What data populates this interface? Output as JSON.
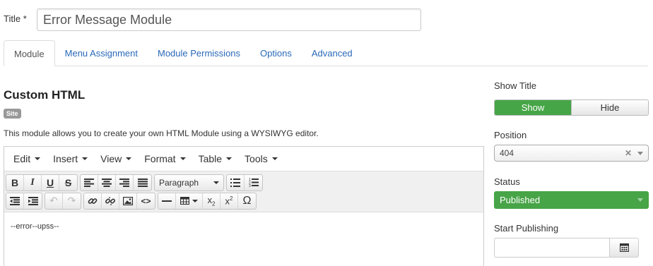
{
  "title": {
    "label": "Title *",
    "value": "Error Message Module"
  },
  "tabs": [
    {
      "label": "Module",
      "active": true
    },
    {
      "label": "Menu Assignment",
      "active": false
    },
    {
      "label": "Module Permissions",
      "active": false
    },
    {
      "label": "Options",
      "active": false
    },
    {
      "label": "Advanced",
      "active": false
    }
  ],
  "module": {
    "heading": "Custom HTML",
    "badge": "Site",
    "description": "This module allows you to create your own HTML Module using a WYSIWYG editor."
  },
  "editor": {
    "menus": [
      "Edit",
      "Insert",
      "View",
      "Format",
      "Table",
      "Tools"
    ],
    "format_select": "Paragraph",
    "content": "--error--upss--"
  },
  "sidebar": {
    "show_title": {
      "label": "Show Title",
      "show": "Show",
      "hide": "Hide",
      "selected": "Show"
    },
    "position": {
      "label": "Position",
      "value": "404"
    },
    "status": {
      "label": "Status",
      "value": "Published"
    },
    "start_publishing": {
      "label": "Start Publishing",
      "value": ""
    }
  },
  "colors": {
    "accent": "#2a69b8",
    "success": "#46a546"
  }
}
